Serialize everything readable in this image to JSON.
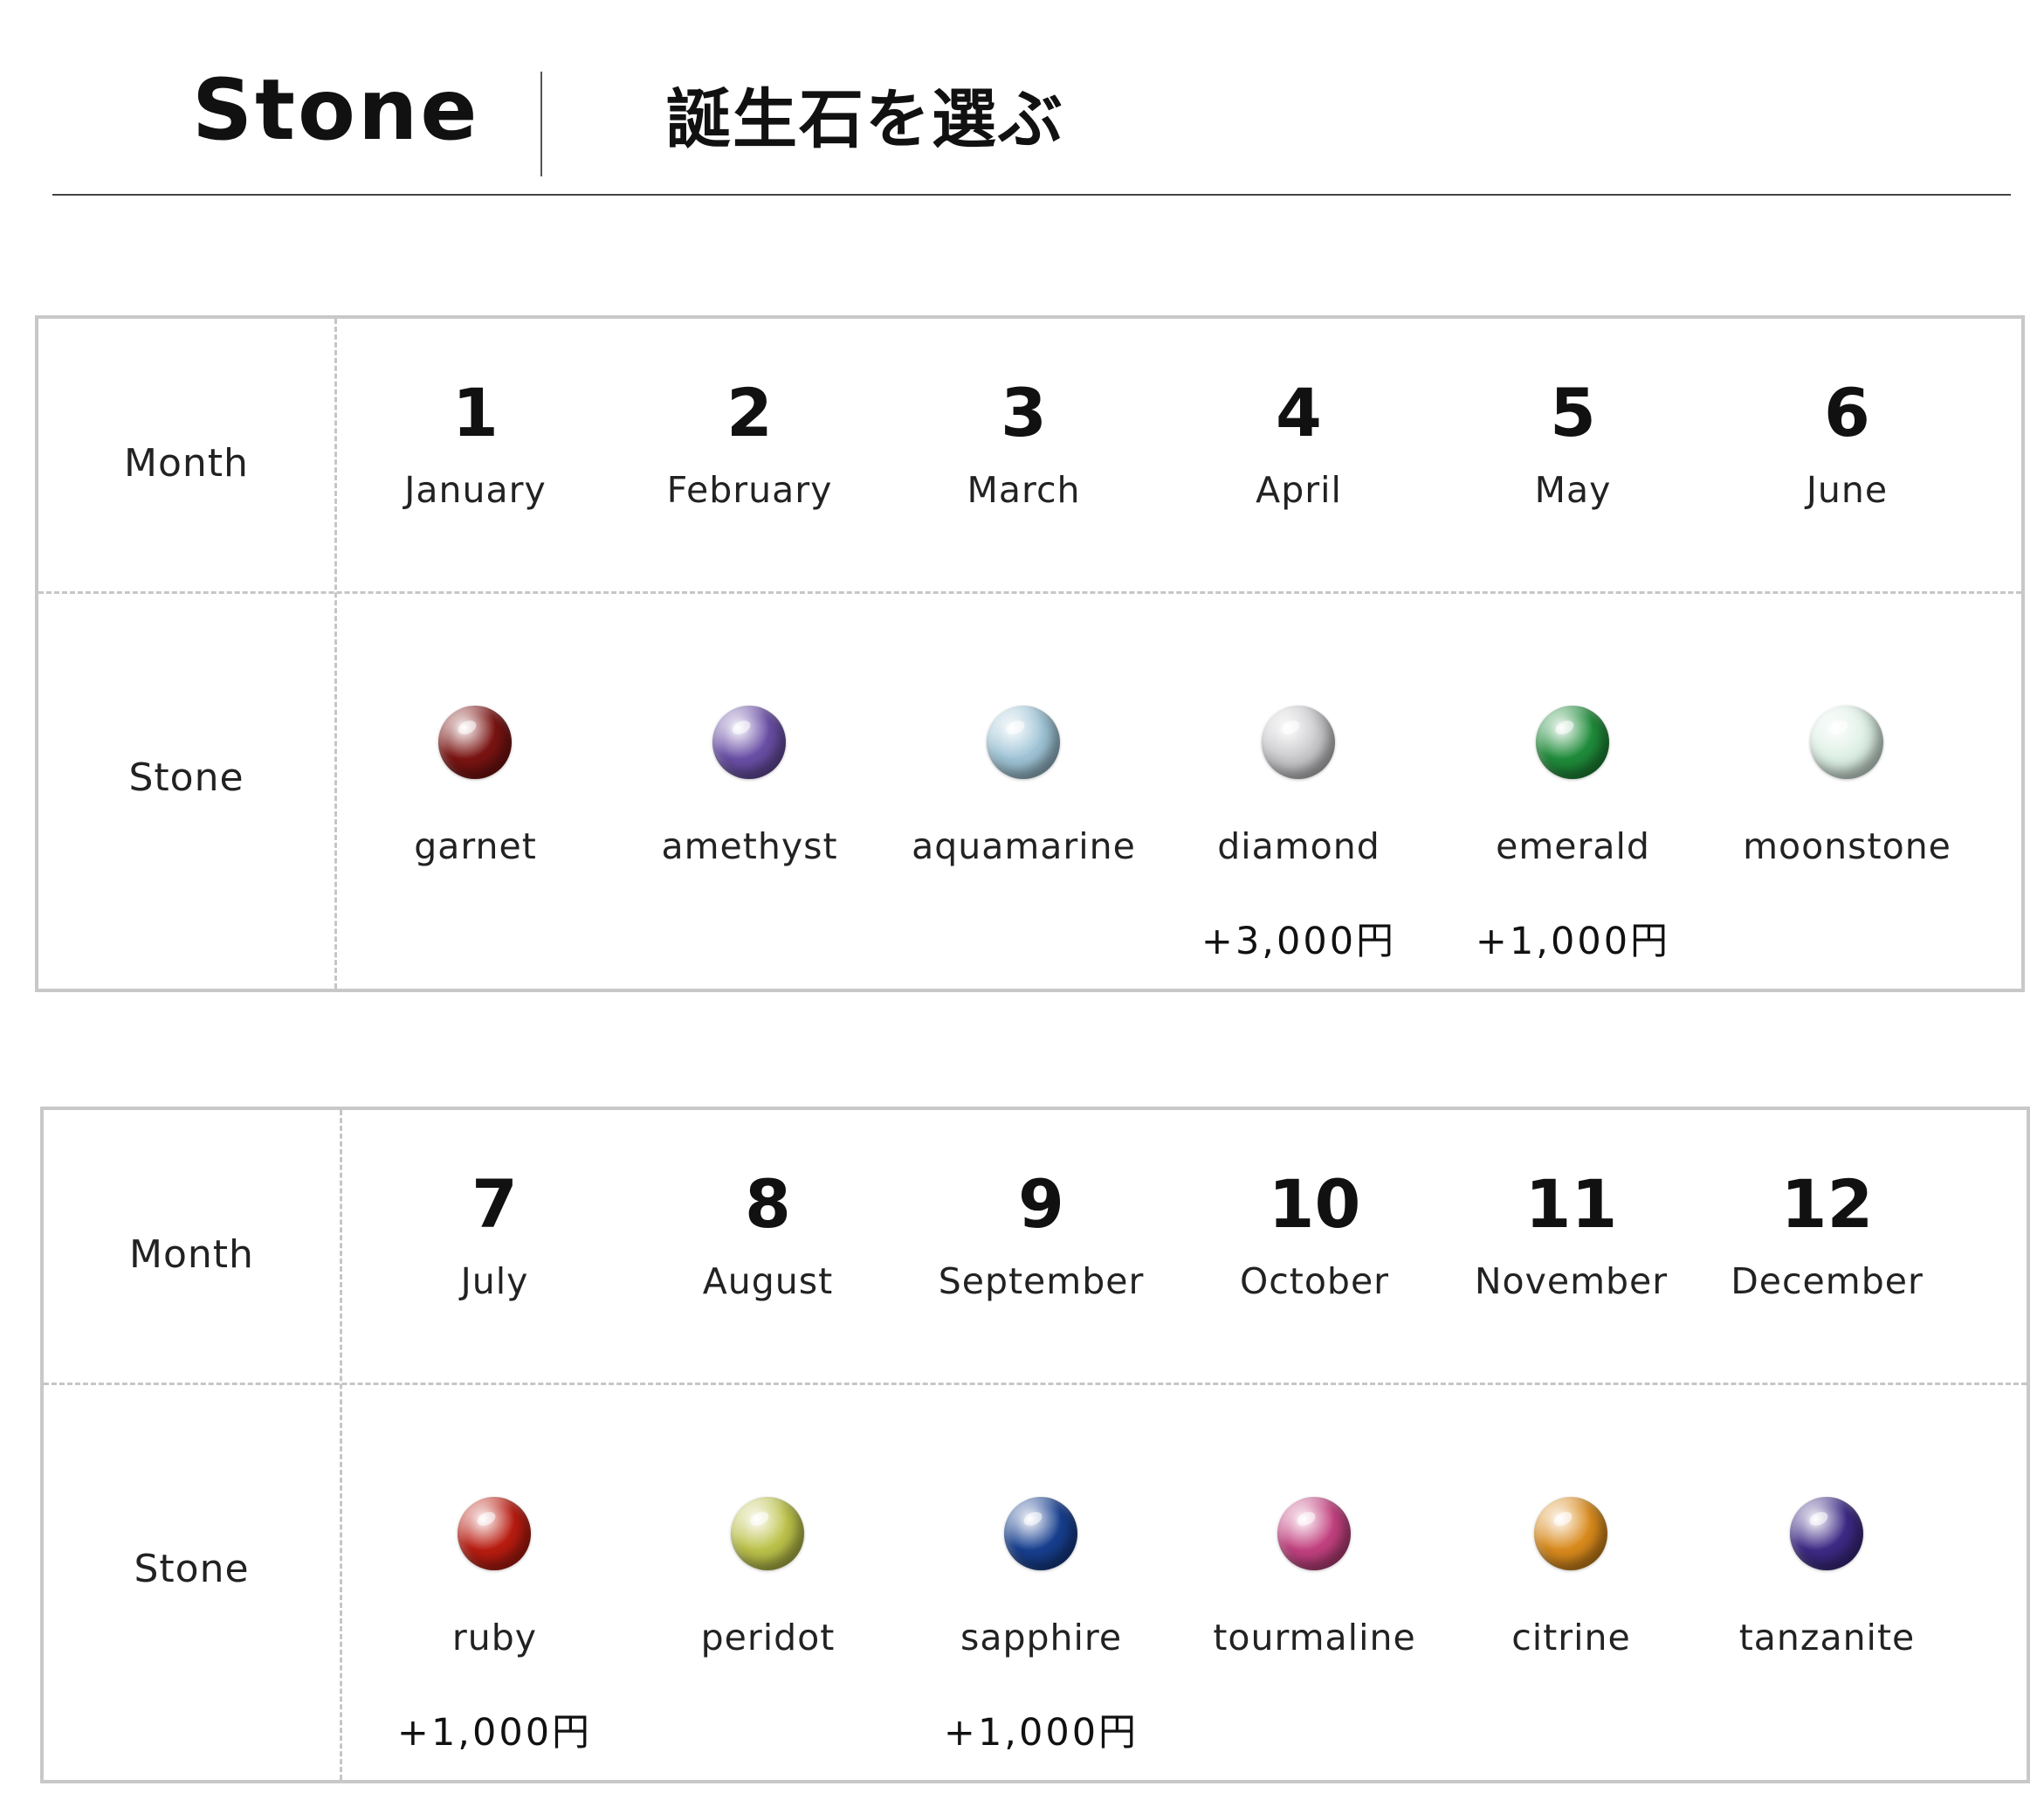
{
  "header": {
    "title_en": "Stone",
    "title_jp": "誕生石を選ぶ"
  },
  "row_labels": {
    "month": "Month",
    "stone": "Stone"
  },
  "tables": [
    {
      "months": [
        {
          "num": "1",
          "name": "January",
          "stone": "garnet",
          "price": "",
          "color": "#7a1412"
        },
        {
          "num": "2",
          "name": "February",
          "stone": "amethyst",
          "price": "",
          "color": "#6a4fa6"
        },
        {
          "num": "3",
          "name": "March",
          "stone": "aquamarine",
          "price": "",
          "color": "#9fc4d6"
        },
        {
          "num": "4",
          "name": "April",
          "stone": "diamond",
          "price": "+3,000円",
          "color": "#c9c9cc"
        },
        {
          "num": "5",
          "name": "May",
          "stone": "emerald",
          "price": "+1,000円",
          "color": "#1f8c3a"
        },
        {
          "num": "6",
          "name": "June",
          "stone": "moonstone",
          "price": "",
          "color": "#dcefe4"
        }
      ]
    },
    {
      "months": [
        {
          "num": "7",
          "name": "July",
          "stone": "ruby",
          "price": "+1,000円",
          "color": "#b81c10"
        },
        {
          "num": "8",
          "name": "August",
          "stone": "peridot",
          "price": "",
          "color": "#bcc24a"
        },
        {
          "num": "9",
          "name": "September",
          "stone": "sapphire",
          "price": "+1,000円",
          "color": "#173f8f"
        },
        {
          "num": "10",
          "name": "October",
          "stone": "tourmaline",
          "price": "",
          "color": "#c2417f"
        },
        {
          "num": "11",
          "name": "November",
          "stone": "citrine",
          "price": "",
          "color": "#d98a1c"
        },
        {
          "num": "12",
          "name": "December",
          "stone": "tanzanite",
          "price": "",
          "color": "#3d2a85"
        }
      ]
    }
  ]
}
